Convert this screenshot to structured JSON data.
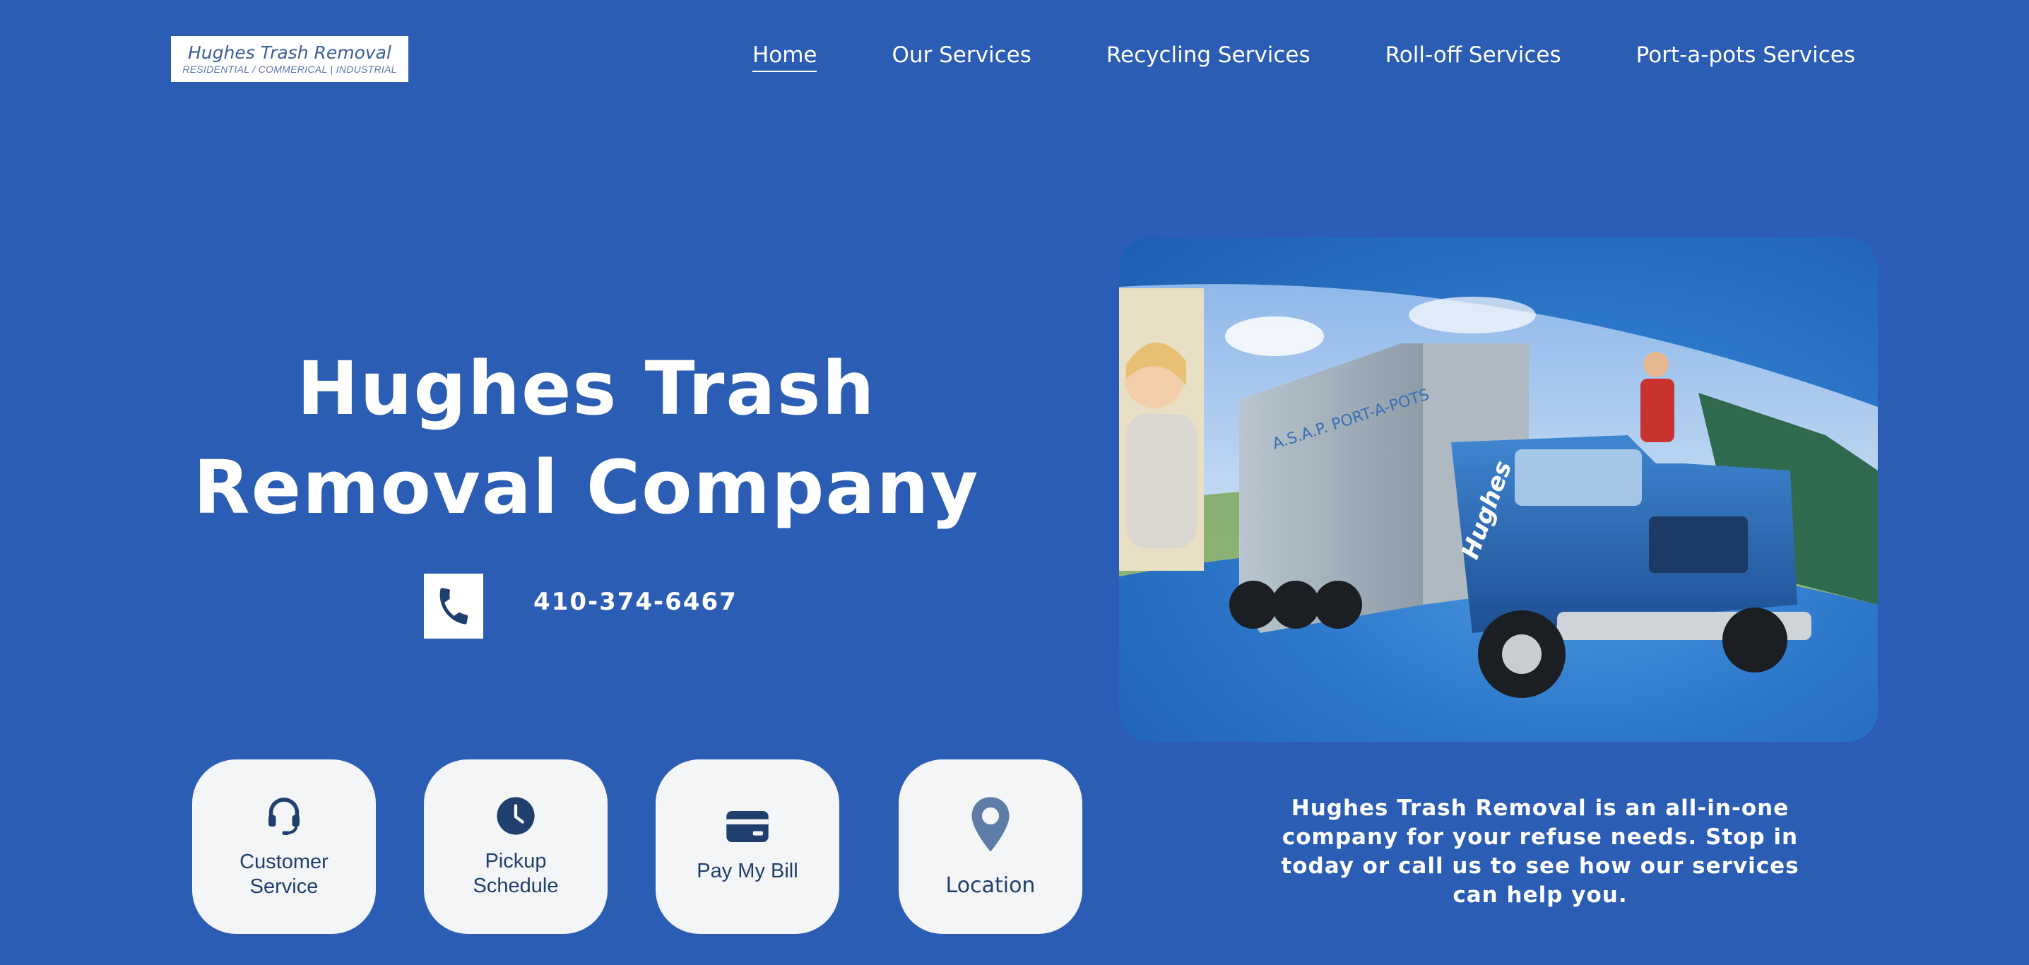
{
  "header": {
    "logo": {
      "title": "Hughes Trash Removal",
      "subtitle": "RESIDENTIAL / COMMERICAL | INDUSTRIAL"
    },
    "nav": [
      {
        "label": "Home",
        "active": true
      },
      {
        "label": "Our Services",
        "active": false
      },
      {
        "label": "Recycling Services",
        "active": false
      },
      {
        "label": "Roll-off Services",
        "active": false
      },
      {
        "label": "Port-a-pots Services",
        "active": false
      }
    ]
  },
  "hero": {
    "title_line1": "Hughes Trash",
    "title_line2": "Removal Company",
    "phone": "410-374-6467",
    "phone_icon": "phone-icon",
    "image": {
      "subject": "blue garbage truck",
      "truck_text": "Hughes"
    }
  },
  "cards": [
    {
      "label": "Customer\nService",
      "icon": "headset-icon"
    },
    {
      "label": "Pickup\nSchedule",
      "icon": "clock-icon"
    },
    {
      "label": "Pay My Bill",
      "icon": "credit-card-icon"
    },
    {
      "label": "Location",
      "icon": "map-pin-icon"
    }
  ],
  "intro": {
    "text": "Hughes Trash Removal is an all-in-one company for your refuse needs. Stop in today or call us to see how our services can help you."
  },
  "colors": {
    "background": "#2a5db3",
    "card_bg": "#f4f5f7",
    "card_text": "#1f3f6e",
    "text": "#ffffff"
  }
}
